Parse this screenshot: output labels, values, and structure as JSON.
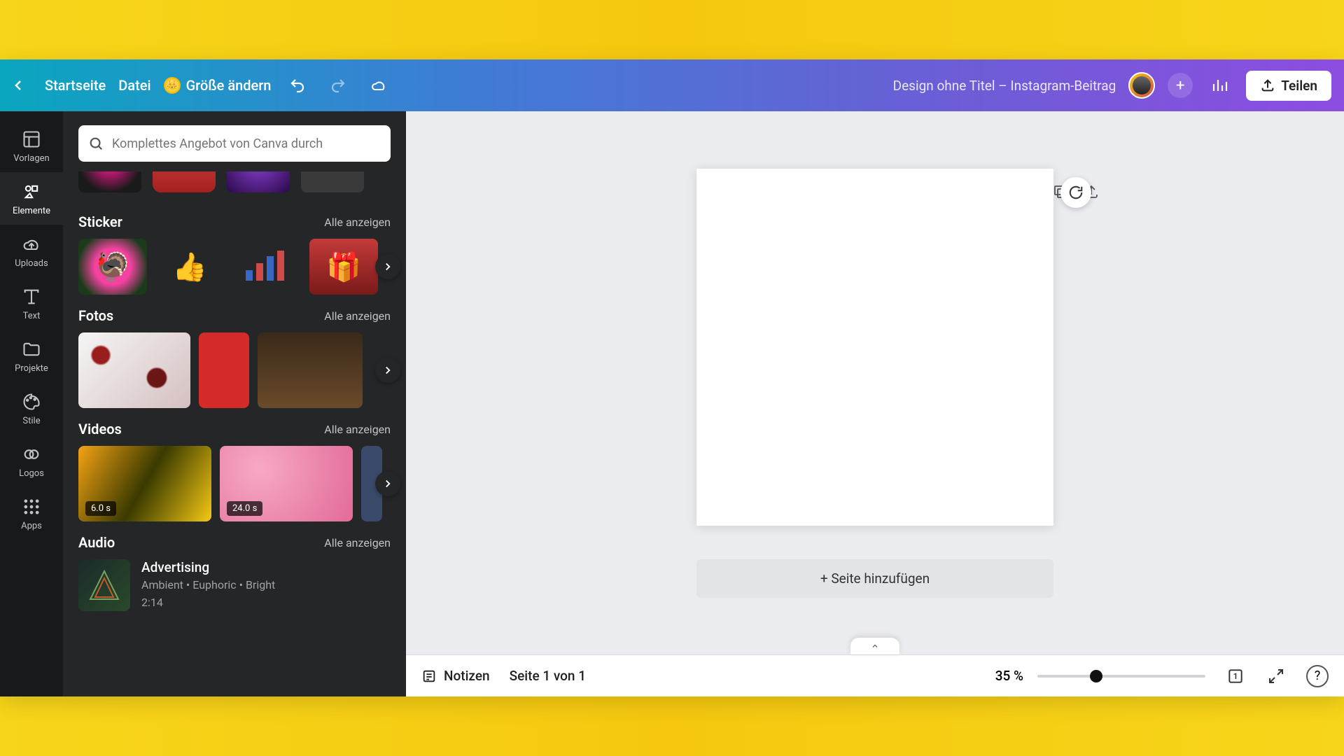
{
  "topbar": {
    "home": "Startseite",
    "file": "Datei",
    "resize": "Größe ändern",
    "doc_title": "Design ohne Titel – Instagram-Beitrag",
    "share": "Teilen"
  },
  "rail": {
    "templates": "Vorlagen",
    "elements": "Elemente",
    "uploads": "Uploads",
    "text": "Text",
    "projects": "Projekte",
    "styles": "Stile",
    "logos": "Logos",
    "apps": "Apps"
  },
  "search": {
    "placeholder": "Komplettes Angebot von Canva durch"
  },
  "sections": {
    "see_all": "Alle anzeigen",
    "sticker": "Sticker",
    "photos": "Fotos",
    "videos": "Videos",
    "audio": "Audio"
  },
  "videos": {
    "d1": "6.0 s",
    "d2": "24.0 s"
  },
  "audio": {
    "title": "Advertising",
    "meta": "Ambient • Euphoric • Bright",
    "time": "2:14"
  },
  "canvas": {
    "add_page": "+ Seite hinzufügen"
  },
  "footer": {
    "notes": "Notizen",
    "page": "Seite 1 von 1",
    "zoom": "35 %",
    "page_badge": "1"
  }
}
